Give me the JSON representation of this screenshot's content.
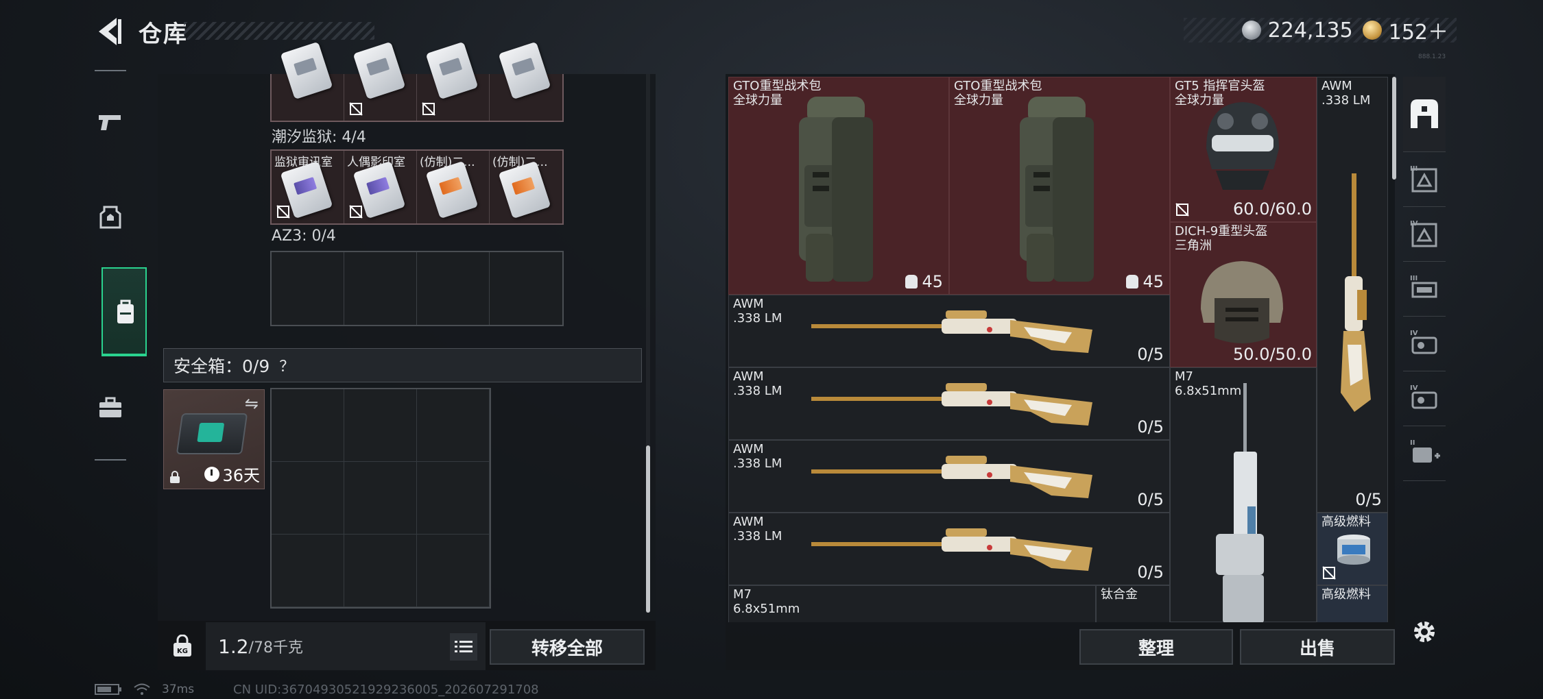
{
  "header": {
    "title": "仓库",
    "currency": {
      "silver": "224,135",
      "gold": "152＋"
    },
    "version_tag": "888.1.23"
  },
  "left_rail": {
    "items": [
      "pistol-icon",
      "armor-vest-icon",
      "backpack-icon",
      "briefcase-icon"
    ],
    "active": "backpack-icon"
  },
  "left_panel": {
    "top_slots": [
      "",
      "",
      "",
      ""
    ],
    "sections": [
      {
        "label": "潮汐监狱: 4/4",
        "slots": [
          "监狱审讯室",
          "人偶影印室",
          "(仿制)二...",
          "(仿制)二..."
        ]
      },
      {
        "label": "AZ3: 0/4",
        "slots": [
          "",
          "",
          "",
          ""
        ]
      }
    ],
    "safe_box": {
      "label": "安全箱：0/9",
      "help": "？",
      "days": "36天"
    },
    "weight": {
      "value": "1.2",
      "unit": "/78千克"
    },
    "transfer_all": "转移全部"
  },
  "right_panel": {
    "items": [
      {
        "name": "GTO重型战术包",
        "sub": "全球力量",
        "weight": "45"
      },
      {
        "name": "GTO重型战术包",
        "sub": "全球力量",
        "weight": "45"
      },
      {
        "name": "GT5 指挥官头盔",
        "sub": "全球力量",
        "durability": "60.0/60.0"
      },
      {
        "name": "DICH-9重型头盔",
        "sub": "三角洲",
        "durability": "50.0/50.0"
      },
      {
        "name": "AWM",
        "sub": ".338 LM",
        "qty": "0/5"
      },
      {
        "name": "AWM",
        "sub": ".338 LM",
        "qty": "0/5"
      },
      {
        "name": "AWM",
        "sub": ".338 LM",
        "qty": "0/5"
      },
      {
        "name": "AWM",
        "sub": ".338 LM",
        "qty": "0/5"
      },
      {
        "name": "AWM",
        "sub": ".338 LM",
        "qty": "0/5"
      },
      {
        "name": "M7",
        "sub": "6.8x51mm"
      },
      {
        "name": "M7",
        "sub": "6.8x51mm"
      },
      {
        "name": "钛合金",
        "sub": ""
      },
      {
        "name": "高级燃料",
        "sub": ""
      },
      {
        "name": "高级燃料",
        "sub": ""
      }
    ],
    "organize": "整理",
    "sell": "出售"
  },
  "right_rail": {
    "items": [
      "storage-icon",
      "tier-3-armor-icon",
      "tier-4-armor-icon",
      "tier-3-vest-icon",
      "tier-4-vest-icon",
      "tier-4-vest-b-icon",
      "add-slot-icon",
      "settings-icon"
    ],
    "tier_labels": [
      "III",
      "IV",
      "III",
      "IV",
      "IV",
      "II"
    ]
  },
  "status": {
    "ping": "37ms",
    "uid": "CN UID:36704930521929236005_202607291708"
  },
  "colors": {
    "accent_green": "#2ad38f",
    "red_rarity": "#4a2327",
    "blue_rarity": "#27303e"
  }
}
